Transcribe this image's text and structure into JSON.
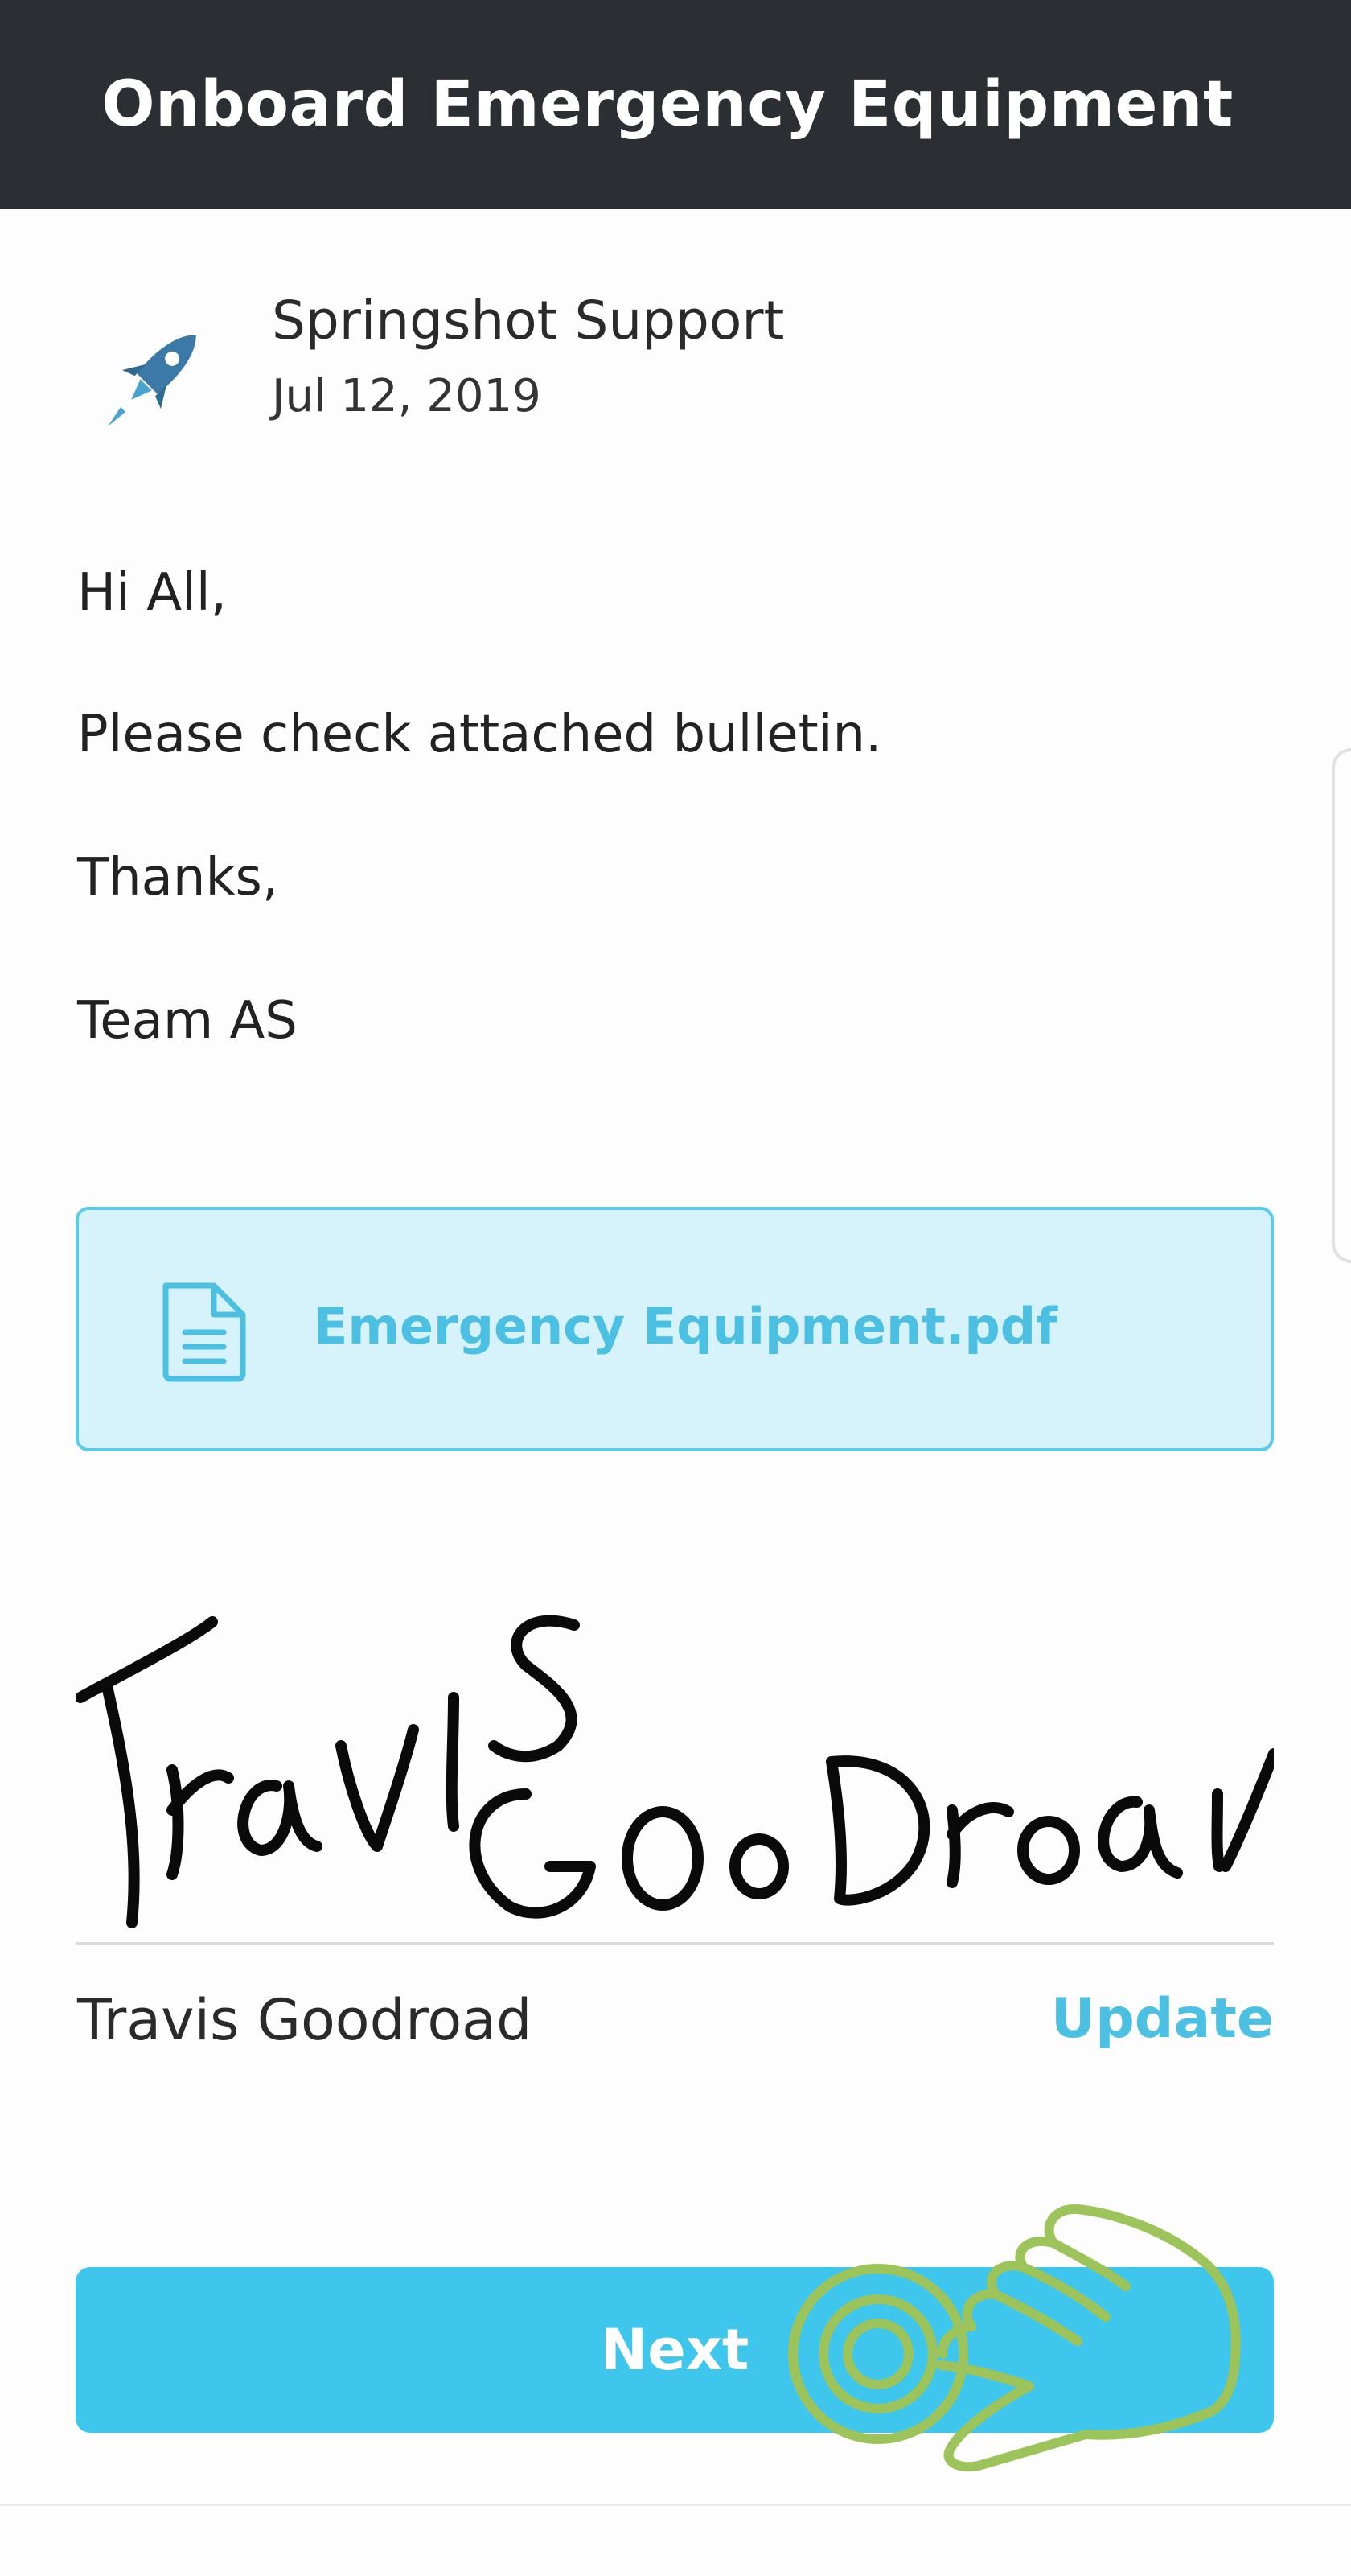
{
  "header": {
    "title": "Onboard Emergency Equipment"
  },
  "post": {
    "sender": "Springshot Support",
    "date": "Jul 12, 2019",
    "avatar_icon": "rocket-icon",
    "body_lines": [
      "Hi All,",
      "Please check attached bulletin.",
      "Thanks,",
      "Team AS"
    ]
  },
  "attachment": {
    "icon": "document-icon",
    "filename": "Emergency Equipment.pdf"
  },
  "signature": {
    "signer_name": "Travis Goodroad",
    "update_label": "Update"
  },
  "actions": {
    "next_label": "Next"
  },
  "overlay": {
    "icon": "tap-hand-icon"
  },
  "colors": {
    "header_bg": "#2b2e33",
    "accent": "#3ec6ec",
    "link": "#4cc0e3",
    "attachment_bg": "#d6f2fb",
    "hand_outline": "#9cc45a"
  }
}
